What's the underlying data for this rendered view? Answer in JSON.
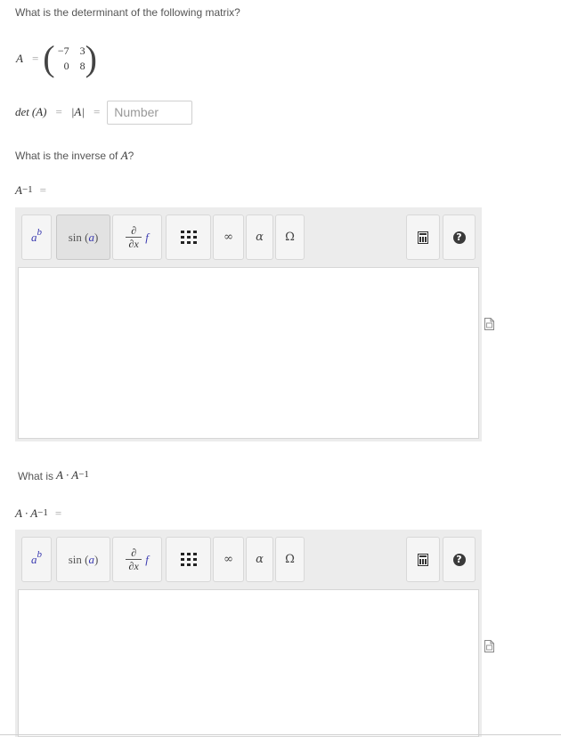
{
  "question1": {
    "prompt": "What is the determinant of the following matrix?",
    "matrix_var": "A",
    "equals": "=",
    "matrix": [
      [
        "−7",
        "3"
      ],
      [
        "0",
        "8"
      ]
    ],
    "det_lhs": "det",
    "det_arg": "(A)",
    "det_eq": "=",
    "det_abs": "|A|",
    "det_eq2": "=",
    "input_placeholder": "Number",
    "input_value": ""
  },
  "question2": {
    "prompt": "What is the inverse of ",
    "prompt_var": "A",
    "prompt_end": "?",
    "lhs_base": "A",
    "lhs_exp": "−1",
    "equals": "="
  },
  "question3": {
    "prompt": "What is ",
    "prompt_expr": "A · A",
    "prompt_exp": "−1",
    "lhs_expr": "A · A",
    "lhs_exp": "−1",
    "equals": "="
  },
  "toolbar": {
    "buttons": [
      {
        "name": "superscript-button",
        "base": "a",
        "exp": "b"
      },
      {
        "name": "function-button",
        "label": "sin",
        "arg": "a"
      },
      {
        "name": "derivative-button",
        "num": "∂",
        "den": "∂x",
        "fn": "f"
      },
      {
        "name": "matrix-button",
        "icon": "matrix-dots-icon"
      },
      {
        "name": "infinity-button",
        "label": "∞"
      },
      {
        "name": "greek-lower-button",
        "label": "α"
      },
      {
        "name": "greek-upper-button",
        "label": "Ω"
      },
      {
        "name": "keyboard-button",
        "icon": "calculator-icon"
      },
      {
        "name": "help-button",
        "label": "?"
      }
    ]
  },
  "side_icon": "document-preview-icon"
}
